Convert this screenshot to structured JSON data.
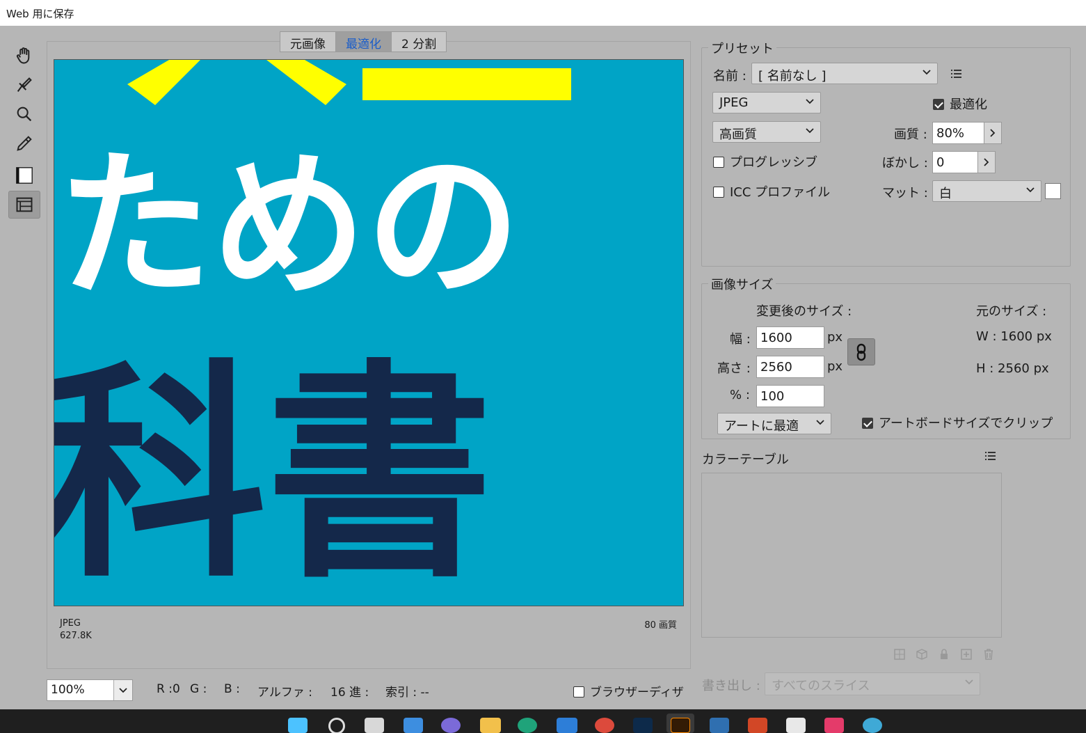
{
  "window": {
    "title": "Web 用に保存"
  },
  "toolbox": {
    "tools": [
      "hand-tool",
      "slice-select-tool",
      "zoom-tool",
      "eyedropper-tool",
      "eyedropper-color",
      "toggle-slices-visibility"
    ]
  },
  "tabs": [
    {
      "label": "元画像",
      "active": false
    },
    {
      "label": "最適化",
      "active": true
    },
    {
      "label": "2 分割",
      "active": false
    }
  ],
  "preview": {
    "background_color": "#00a4c6",
    "line1": "ための",
    "line2": "科書",
    "format_label": "JPEG",
    "file_size": "627.8K",
    "quality_label": "80 画質"
  },
  "bottom": {
    "zoom": "100%",
    "r": "R :0",
    "g": "G :",
    "b": "B :",
    "alpha": "アルファ :",
    "hex": "16 進 :",
    "index": "索引 : --",
    "browser_dither": "ブラウザーディザ"
  },
  "preset": {
    "legend": "プリセット",
    "name_label": "名前 :",
    "name_value": "[ 名前なし ]",
    "format": "JPEG",
    "optimize_label": "最適化",
    "optimize_checked": true,
    "quality_preset": "高画質",
    "quality_label": "画質 :",
    "quality_value": "80%",
    "progressive_label": "プログレッシブ",
    "progressive_checked": false,
    "blur_label": "ぼかし :",
    "blur_value": "0",
    "icc_label": "ICC プロファイル",
    "icc_checked": false,
    "matte_label": "マット :",
    "matte_value": "白"
  },
  "image_size": {
    "legend": "画像サイズ",
    "new_size_label": "変更後のサイズ :",
    "orig_size_label": "元のサイズ :",
    "width_label": "幅 :",
    "width_value": "1600",
    "height_label": "高さ :",
    "height_value": "2560",
    "percent_label": "% :",
    "percent_value": "100",
    "px": "px",
    "orig_w": "W :  1600 px",
    "orig_h": "H :  2560 px",
    "fit_select": "アートに最適",
    "clip_label": "アートボードサイズでクリップ",
    "clip_checked": true
  },
  "color_table": {
    "title": "カラーテーブル"
  },
  "export": {
    "label": "書き出し :",
    "value": "すべてのスライス"
  }
}
